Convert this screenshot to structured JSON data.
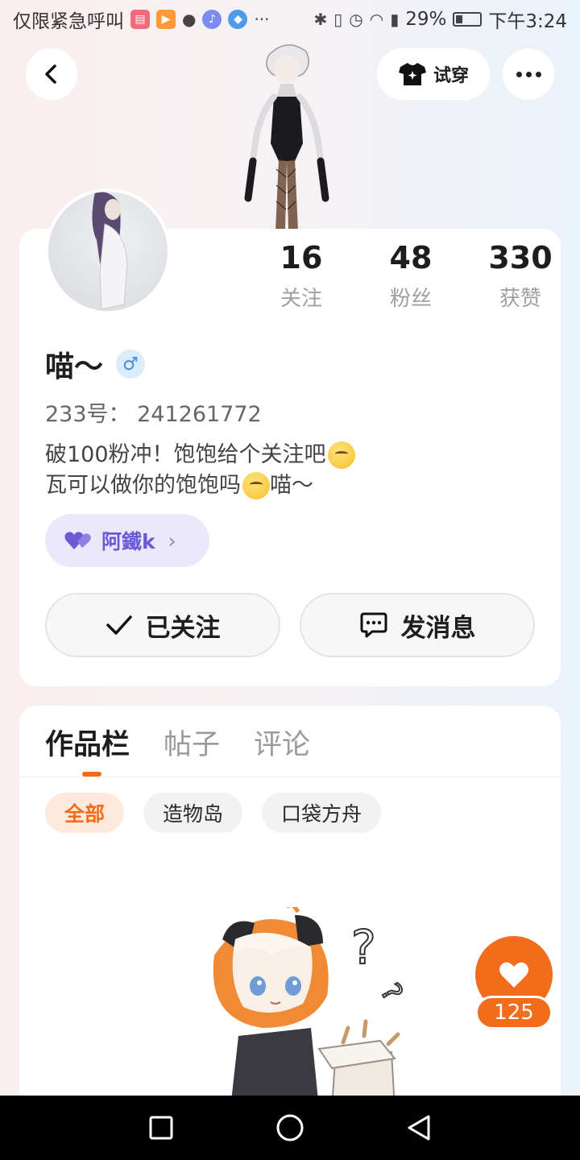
{
  "status_bar": {
    "carrier_text": "仅限紧急呼叫",
    "battery": "29%",
    "time": "下午3:24",
    "more": "···"
  },
  "header": {
    "try_on_label": "试穿"
  },
  "profile": {
    "stats": [
      {
        "value": "16",
        "label": "关注"
      },
      {
        "value": "48",
        "label": "粉丝"
      },
      {
        "value": "330",
        "label": "获赞"
      }
    ],
    "username": "喵～",
    "gender_symbol": "♂",
    "user_id": "233号： 241261772",
    "bio_line1": "破100粉冲！饱饱给个关注吧",
    "bio_line2": "瓦可以做你的饱饱吗",
    "bio_line2_suffix": "喵～",
    "cp_name": "阿鐵k",
    "cp_chevron": "›",
    "follow_label": "已关注",
    "message_label": "发消息"
  },
  "works": {
    "tabs": [
      "作品栏",
      "帖子",
      "评论"
    ],
    "filters": [
      "全部",
      "造物岛",
      "口袋方舟"
    ]
  },
  "like": {
    "count": "125"
  },
  "colors": {
    "accent": "#f26c1b",
    "cp_tag_bg": "#ebe8fb",
    "cp_tag_text": "#6a5ad6"
  }
}
